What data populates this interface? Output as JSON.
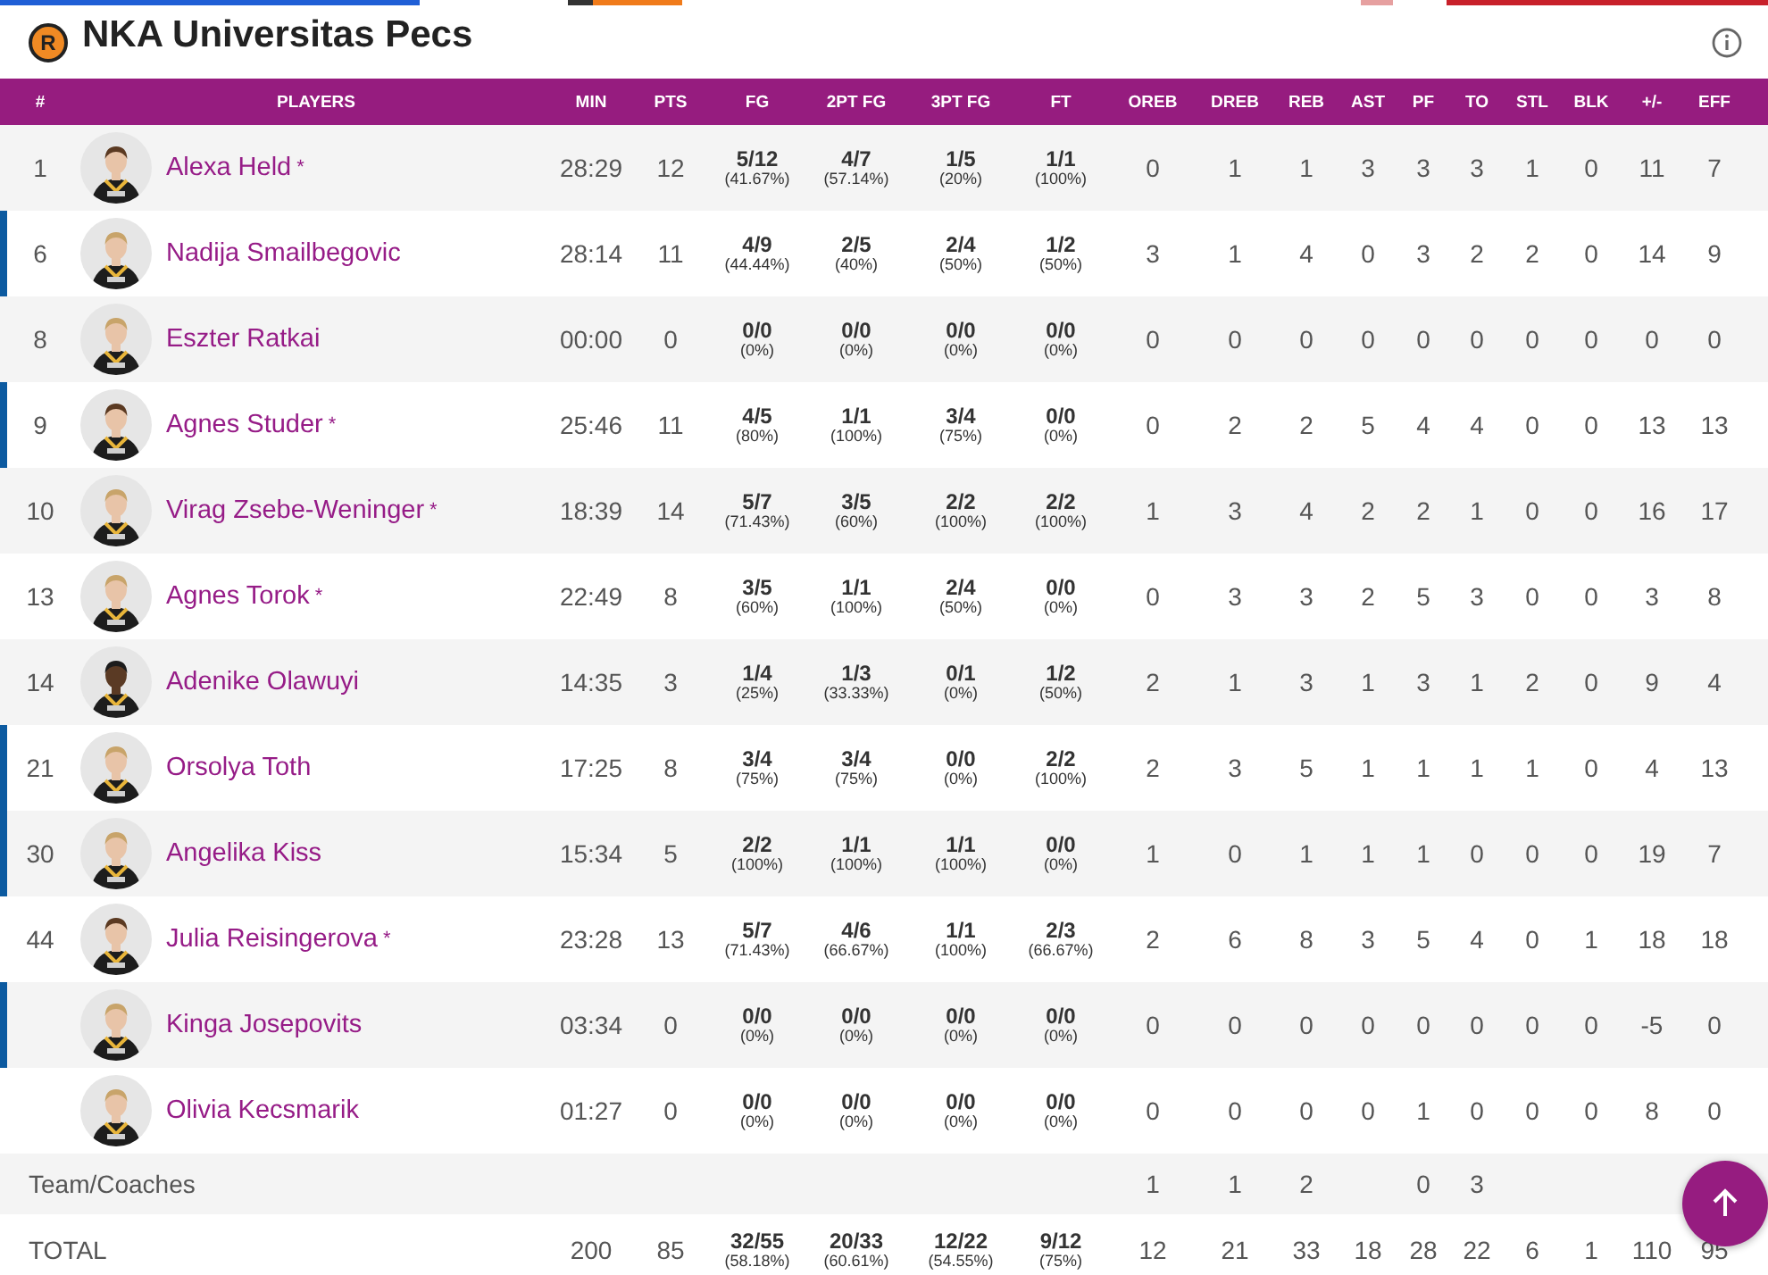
{
  "team": {
    "logo_letter": "R",
    "name": "NKA Universitas Pecs"
  },
  "columns": [
    "#",
    "PLAYERS",
    "MIN",
    "PTS",
    "FG",
    "2PT FG",
    "3PT FG",
    "FT",
    "OREB",
    "DREB",
    "REB",
    "AST",
    "PF",
    "TO",
    "STL",
    "BLK",
    "+/-",
    "EFF"
  ],
  "players": [
    {
      "number": "1",
      "name": "Alexa Held",
      "mark": "*",
      "highlighted": false,
      "min": "28:29",
      "pts": "12",
      "shooting": [
        {
          "ratio": "5/12",
          "pct": "(41.67%)"
        },
        {
          "ratio": "4/7",
          "pct": "(57.14%)"
        },
        {
          "ratio": "1/5",
          "pct": "(20%)"
        },
        {
          "ratio": "1/1",
          "pct": "(100%)"
        }
      ],
      "stats": [
        "0",
        "1",
        "1",
        "3",
        "3",
        "3",
        "1",
        "0",
        "11",
        "7"
      ]
    },
    {
      "number": "6",
      "name": "Nadija Smailbegovic",
      "highlighted": true,
      "min": "28:14",
      "pts": "11",
      "shooting": [
        {
          "ratio": "4/9",
          "pct": "(44.44%)"
        },
        {
          "ratio": "2/5",
          "pct": "(40%)"
        },
        {
          "ratio": "2/4",
          "pct": "(50%)"
        },
        {
          "ratio": "1/2",
          "pct": "(50%)"
        }
      ],
      "stats": [
        "3",
        "1",
        "4",
        "0",
        "3",
        "2",
        "2",
        "0",
        "14",
        "9"
      ]
    },
    {
      "number": "8",
      "name": "Eszter Ratkai",
      "highlighted": false,
      "min": "00:00",
      "pts": "0",
      "shooting": [
        {
          "ratio": "0/0",
          "pct": "(0%)"
        },
        {
          "ratio": "0/0",
          "pct": "(0%)"
        },
        {
          "ratio": "0/0",
          "pct": "(0%)"
        },
        {
          "ratio": "0/0",
          "pct": "(0%)"
        }
      ],
      "stats": [
        "0",
        "0",
        "0",
        "0",
        "0",
        "0",
        "0",
        "0",
        "0",
        "0"
      ]
    },
    {
      "number": "9",
      "name": "Agnes Studer",
      "mark": "*",
      "highlighted": true,
      "min": "25:46",
      "pts": "11",
      "shooting": [
        {
          "ratio": "4/5",
          "pct": "(80%)"
        },
        {
          "ratio": "1/1",
          "pct": "(100%)"
        },
        {
          "ratio": "3/4",
          "pct": "(75%)"
        },
        {
          "ratio": "0/0",
          "pct": "(0%)"
        }
      ],
      "stats": [
        "0",
        "2",
        "2",
        "5",
        "4",
        "4",
        "0",
        "0",
        "13",
        "13"
      ]
    },
    {
      "number": "10",
      "name": "Virag Zsebe-Weninger",
      "mark": "*",
      "highlighted": false,
      "min": "18:39",
      "pts": "14",
      "shooting": [
        {
          "ratio": "5/7",
          "pct": "(71.43%)"
        },
        {
          "ratio": "3/5",
          "pct": "(60%)"
        },
        {
          "ratio": "2/2",
          "pct": "(100%)"
        },
        {
          "ratio": "2/2",
          "pct": "(100%)"
        }
      ],
      "stats": [
        "1",
        "3",
        "4",
        "2",
        "2",
        "1",
        "0",
        "0",
        "16",
        "17"
      ]
    },
    {
      "number": "13",
      "name": "Agnes Torok",
      "mark": "*",
      "highlighted": false,
      "min": "22:49",
      "pts": "8",
      "shooting": [
        {
          "ratio": "3/5",
          "pct": "(60%)"
        },
        {
          "ratio": "1/1",
          "pct": "(100%)"
        },
        {
          "ratio": "2/4",
          "pct": "(50%)"
        },
        {
          "ratio": "0/0",
          "pct": "(0%)"
        }
      ],
      "stats": [
        "0",
        "3",
        "3",
        "2",
        "5",
        "3",
        "0",
        "0",
        "3",
        "8"
      ]
    },
    {
      "number": "14",
      "name": "Adenike Olawuyi",
      "highlighted": false,
      "min": "14:35",
      "pts": "3",
      "shooting": [
        {
          "ratio": "1/4",
          "pct": "(25%)"
        },
        {
          "ratio": "1/3",
          "pct": "(33.33%)"
        },
        {
          "ratio": "0/1",
          "pct": "(0%)"
        },
        {
          "ratio": "1/2",
          "pct": "(50%)"
        }
      ],
      "stats": [
        "2",
        "1",
        "3",
        "1",
        "3",
        "1",
        "2",
        "0",
        "9",
        "4"
      ]
    },
    {
      "number": "21",
      "name": "Orsolya Toth",
      "highlighted": true,
      "min": "17:25",
      "pts": "8",
      "shooting": [
        {
          "ratio": "3/4",
          "pct": "(75%)"
        },
        {
          "ratio": "3/4",
          "pct": "(75%)"
        },
        {
          "ratio": "0/0",
          "pct": "(0%)"
        },
        {
          "ratio": "2/2",
          "pct": "(100%)"
        }
      ],
      "stats": [
        "2",
        "3",
        "5",
        "1",
        "1",
        "1",
        "1",
        "0",
        "4",
        "13"
      ]
    },
    {
      "number": "30",
      "name": "Angelika Kiss",
      "highlighted": true,
      "min": "15:34",
      "pts": "5",
      "shooting": [
        {
          "ratio": "2/2",
          "pct": "(100%)"
        },
        {
          "ratio": "1/1",
          "pct": "(100%)"
        },
        {
          "ratio": "1/1",
          "pct": "(100%)"
        },
        {
          "ratio": "0/0",
          "pct": "(0%)"
        }
      ],
      "stats": [
        "1",
        "0",
        "1",
        "1",
        "1",
        "0",
        "0",
        "0",
        "19",
        "7"
      ]
    },
    {
      "number": "44",
      "name": "Julia Reisingerova",
      "mark": "*",
      "highlighted": false,
      "min": "23:28",
      "pts": "13",
      "shooting": [
        {
          "ratio": "5/7",
          "pct": "(71.43%)"
        },
        {
          "ratio": "4/6",
          "pct": "(66.67%)"
        },
        {
          "ratio": "1/1",
          "pct": "(100%)"
        },
        {
          "ratio": "2/3",
          "pct": "(66.67%)"
        }
      ],
      "stats": [
        "2",
        "6",
        "8",
        "3",
        "5",
        "4",
        "0",
        "1",
        "18",
        "18"
      ]
    },
    {
      "name": "Kinga Josepovits",
      "highlighted": true,
      "min": "03:34",
      "pts": "0",
      "shooting": [
        {
          "ratio": "0/0",
          "pct": "(0%)"
        },
        {
          "ratio": "0/0",
          "pct": "(0%)"
        },
        {
          "ratio": "0/0",
          "pct": "(0%)"
        },
        {
          "ratio": "0/0",
          "pct": "(0%)"
        }
      ],
      "stats": [
        "0",
        "0",
        "0",
        "0",
        "0",
        "0",
        "0",
        "0",
        "-5",
        "0"
      ]
    },
    {
      "name": "Olivia Kecsmarik",
      "highlighted": false,
      "min": "01:27",
      "pts": "0",
      "shooting": [
        {
          "ratio": "0/0",
          "pct": "(0%)"
        },
        {
          "ratio": "0/0",
          "pct": "(0%)"
        },
        {
          "ratio": "0/0",
          "pct": "(0%)"
        },
        {
          "ratio": "0/0",
          "pct": "(0%)"
        }
      ],
      "stats": [
        "0",
        "0",
        "0",
        "0",
        "1",
        "0",
        "0",
        "0",
        "8",
        "0"
      ]
    }
  ],
  "team_coaches": {
    "label": "Team/Coaches",
    "stats": {
      "oreb": "1",
      "dreb": "1",
      "reb": "2",
      "pf": "0",
      "to": "3"
    }
  },
  "totals": {
    "label": "TOTAL",
    "min": "200",
    "pts": "85",
    "shooting": [
      {
        "ratio": "32/55",
        "pct": "(58.18%)"
      },
      {
        "ratio": "20/33",
        "pct": "(60.61%)"
      },
      {
        "ratio": "12/22",
        "pct": "(54.55%)"
      },
      {
        "ratio": "9/12",
        "pct": "(75%)"
      }
    ],
    "stats": [
      "12",
      "21",
      "33",
      "18",
      "28",
      "22",
      "6",
      "1",
      "110",
      "95"
    ]
  }
}
